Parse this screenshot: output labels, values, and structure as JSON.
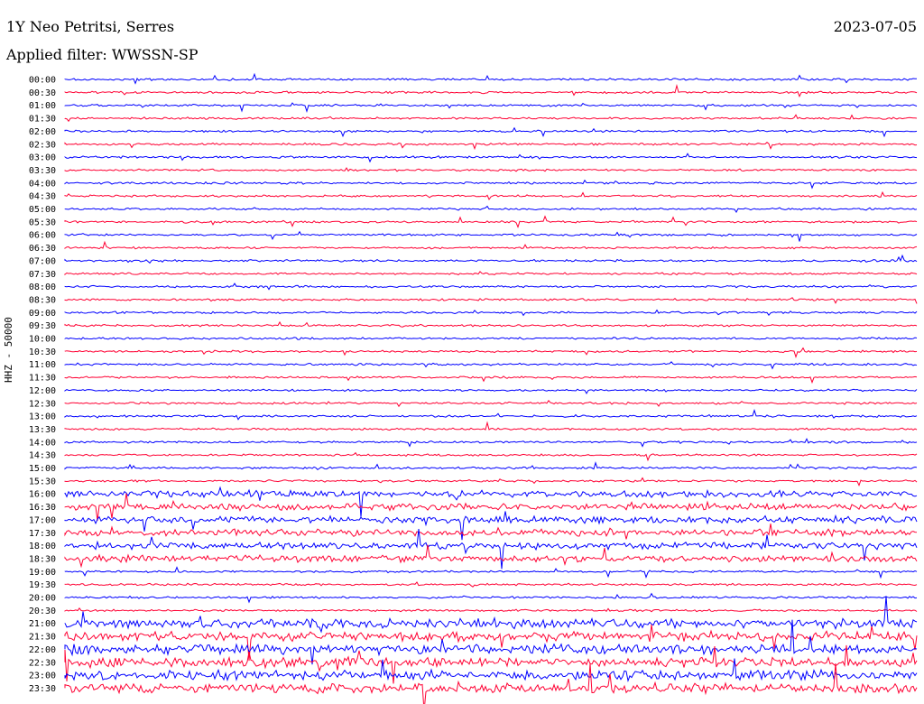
{
  "header": {
    "station": "1Y Neo Petritsi, Serres",
    "date": "2023-07-05",
    "filter_label": "Applied filter: WWSSN-SP"
  },
  "chart_data": {
    "type": "line",
    "title": "1Y Neo Petritsi, Serres",
    "subtitle": "Applied filter: WWSSN-SP",
    "ylabel": "HHZ - 50000",
    "date": "2023-07-05",
    "row_labels": [
      "00:00",
      "00:30",
      "01:00",
      "01:30",
      "02:00",
      "02:30",
      "03:00",
      "03:30",
      "04:00",
      "04:30",
      "05:00",
      "05:30",
      "06:00",
      "06:30",
      "07:00",
      "07:30",
      "08:00",
      "08:30",
      "09:00",
      "09:30",
      "10:00",
      "10:30",
      "11:00",
      "11:30",
      "12:00",
      "12:30",
      "13:00",
      "13:30",
      "14:00",
      "14:30",
      "15:00",
      "15:30",
      "16:00",
      "16:30",
      "17:00",
      "17:30",
      "18:00",
      "18:30",
      "19:00",
      "19:30",
      "20:00",
      "20:30",
      "21:00",
      "21:30",
      "22:00",
      "22:30",
      "23:00",
      "23:30"
    ],
    "colors": [
      "#0000ff",
      "#ff0033"
    ],
    "grid": false,
    "legend": "none"
  }
}
